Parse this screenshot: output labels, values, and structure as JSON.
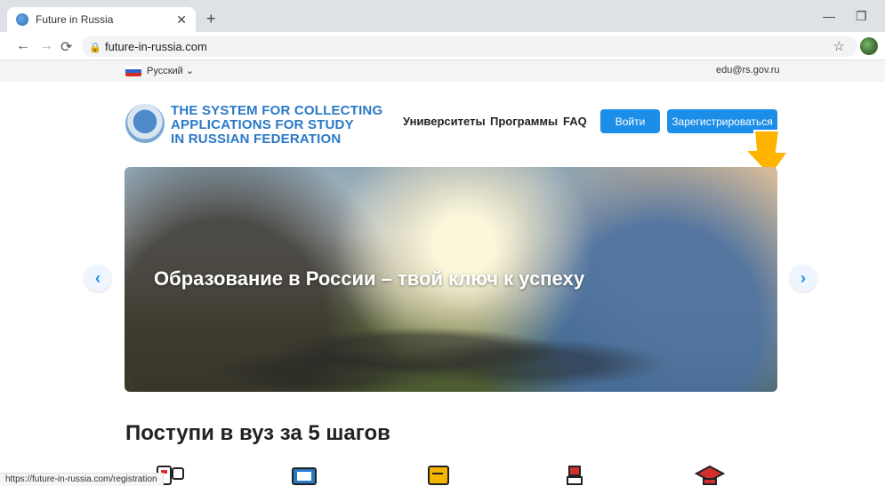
{
  "browser": {
    "tab_title": "Future in Russia",
    "url": "future-in-russia.com",
    "status_url": "https://future-in-russia.com/registration"
  },
  "topbar": {
    "language": "Русский ⌄",
    "email": "edu@rs.gov.ru"
  },
  "header": {
    "logo_lines": [
      "THE SYSTEM FOR COLLECTING",
      "APPLICATIONS FOR STUDY",
      "IN RUSSIAN FEDERATION"
    ],
    "nav": [
      "Университеты",
      "Программы",
      "FAQ"
    ],
    "login": "Войти",
    "register": "Зарегистрироваться"
  },
  "banner": {
    "title": "Образование в России – твой ключ к успеху"
  },
  "section": {
    "title": "Поступи в вуз за 5 шагов"
  },
  "colors": {
    "accent": "#1d8ee8",
    "cursor_arrow": "#ffb400"
  },
  "icons": [
    "step-1-icon",
    "step-2-icon",
    "step-3-icon",
    "step-4-icon",
    "step-5-icon"
  ]
}
